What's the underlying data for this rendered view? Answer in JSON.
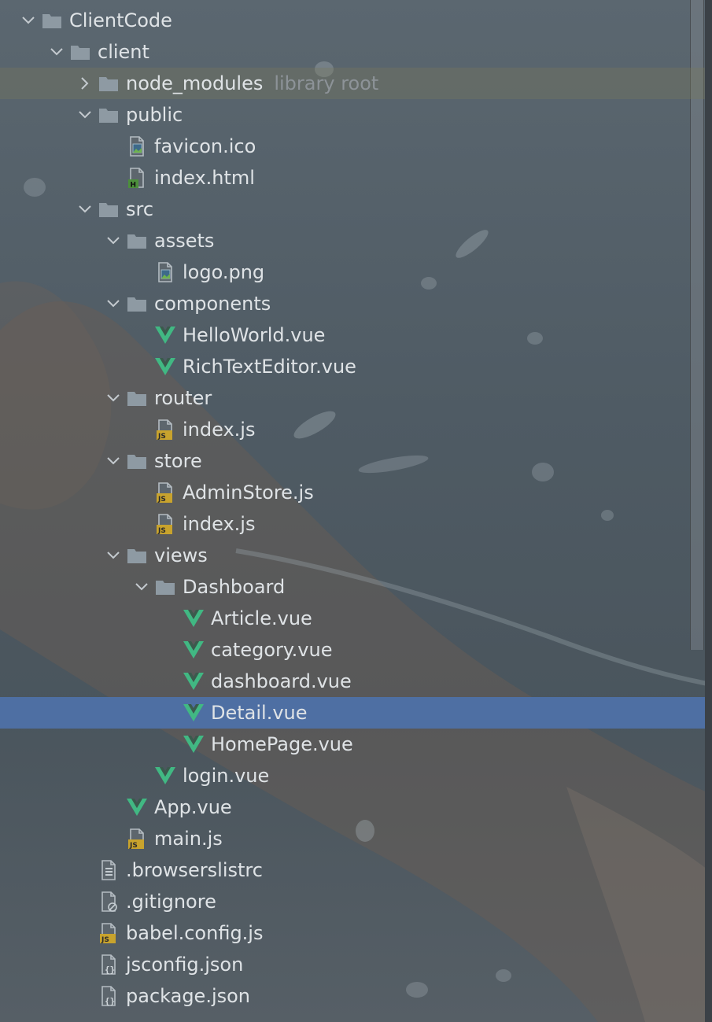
{
  "theme": {
    "folder_color": "#8e9aa3",
    "vue_color": "#41b883",
    "js_badge_color": "#c8a32d",
    "html_badge_color": "#4c8f3b",
    "selected_row_color": "#4e6fa3"
  },
  "tree": [
    {
      "level": 0,
      "expanded": true,
      "icon": "folder-icon",
      "label": "ClientCode"
    },
    {
      "level": 1,
      "expanded": true,
      "icon": "folder-icon",
      "label": "client"
    },
    {
      "level": 2,
      "expanded": false,
      "icon": "folder-icon",
      "label": "node_modules",
      "suffix": "library root",
      "highlight": "library"
    },
    {
      "level": 2,
      "expanded": true,
      "icon": "folder-icon",
      "label": "public"
    },
    {
      "level": 3,
      "icon": "image-file-icon",
      "label": "favicon.ico"
    },
    {
      "level": 3,
      "icon": "html-file-icon",
      "label": "index.html"
    },
    {
      "level": 2,
      "expanded": true,
      "icon": "folder-icon",
      "label": "src"
    },
    {
      "level": 3,
      "expanded": true,
      "icon": "folder-icon",
      "label": "assets"
    },
    {
      "level": 4,
      "icon": "image-file-icon",
      "label": "logo.png"
    },
    {
      "level": 3,
      "expanded": true,
      "icon": "folder-icon",
      "label": "components"
    },
    {
      "level": 4,
      "icon": "vue-file-icon",
      "label": "HelloWorld.vue"
    },
    {
      "level": 4,
      "icon": "vue-file-icon",
      "label": "RichTextEditor.vue"
    },
    {
      "level": 3,
      "expanded": true,
      "icon": "folder-icon",
      "label": "router"
    },
    {
      "level": 4,
      "icon": "js-file-icon",
      "label": "index.js"
    },
    {
      "level": 3,
      "expanded": true,
      "icon": "folder-icon",
      "label": "store"
    },
    {
      "level": 4,
      "icon": "js-file-icon",
      "label": "AdminStore.js"
    },
    {
      "level": 4,
      "icon": "js-file-icon",
      "label": "index.js"
    },
    {
      "level": 3,
      "expanded": true,
      "icon": "folder-icon",
      "label": "views"
    },
    {
      "level": 4,
      "expanded": true,
      "icon": "folder-icon",
      "label": "Dashboard"
    },
    {
      "level": 5,
      "icon": "vue-file-icon",
      "label": "Article.vue"
    },
    {
      "level": 5,
      "icon": "vue-file-icon",
      "label": "category.vue"
    },
    {
      "level": 5,
      "icon": "vue-file-icon",
      "label": "dashboard.vue"
    },
    {
      "level": 5,
      "icon": "vue-file-icon",
      "label": "Detail.vue",
      "selected": true
    },
    {
      "level": 5,
      "icon": "vue-file-icon",
      "label": "HomePage.vue"
    },
    {
      "level": 4,
      "icon": "vue-file-icon",
      "label": "login.vue"
    },
    {
      "level": 3,
      "icon": "vue-file-icon",
      "label": "App.vue"
    },
    {
      "level": 3,
      "icon": "js-file-icon",
      "label": "main.js"
    },
    {
      "level": 2,
      "icon": "text-file-icon",
      "label": ".browserslistrc"
    },
    {
      "level": 2,
      "icon": "ignore-file-icon",
      "label": ".gitignore"
    },
    {
      "level": 2,
      "icon": "js-file-icon",
      "label": "babel.config.js"
    },
    {
      "level": 2,
      "icon": "json-file-icon",
      "label": "jsconfig.json"
    },
    {
      "level": 2,
      "icon": "json-file-icon",
      "label": "package.json"
    }
  ]
}
